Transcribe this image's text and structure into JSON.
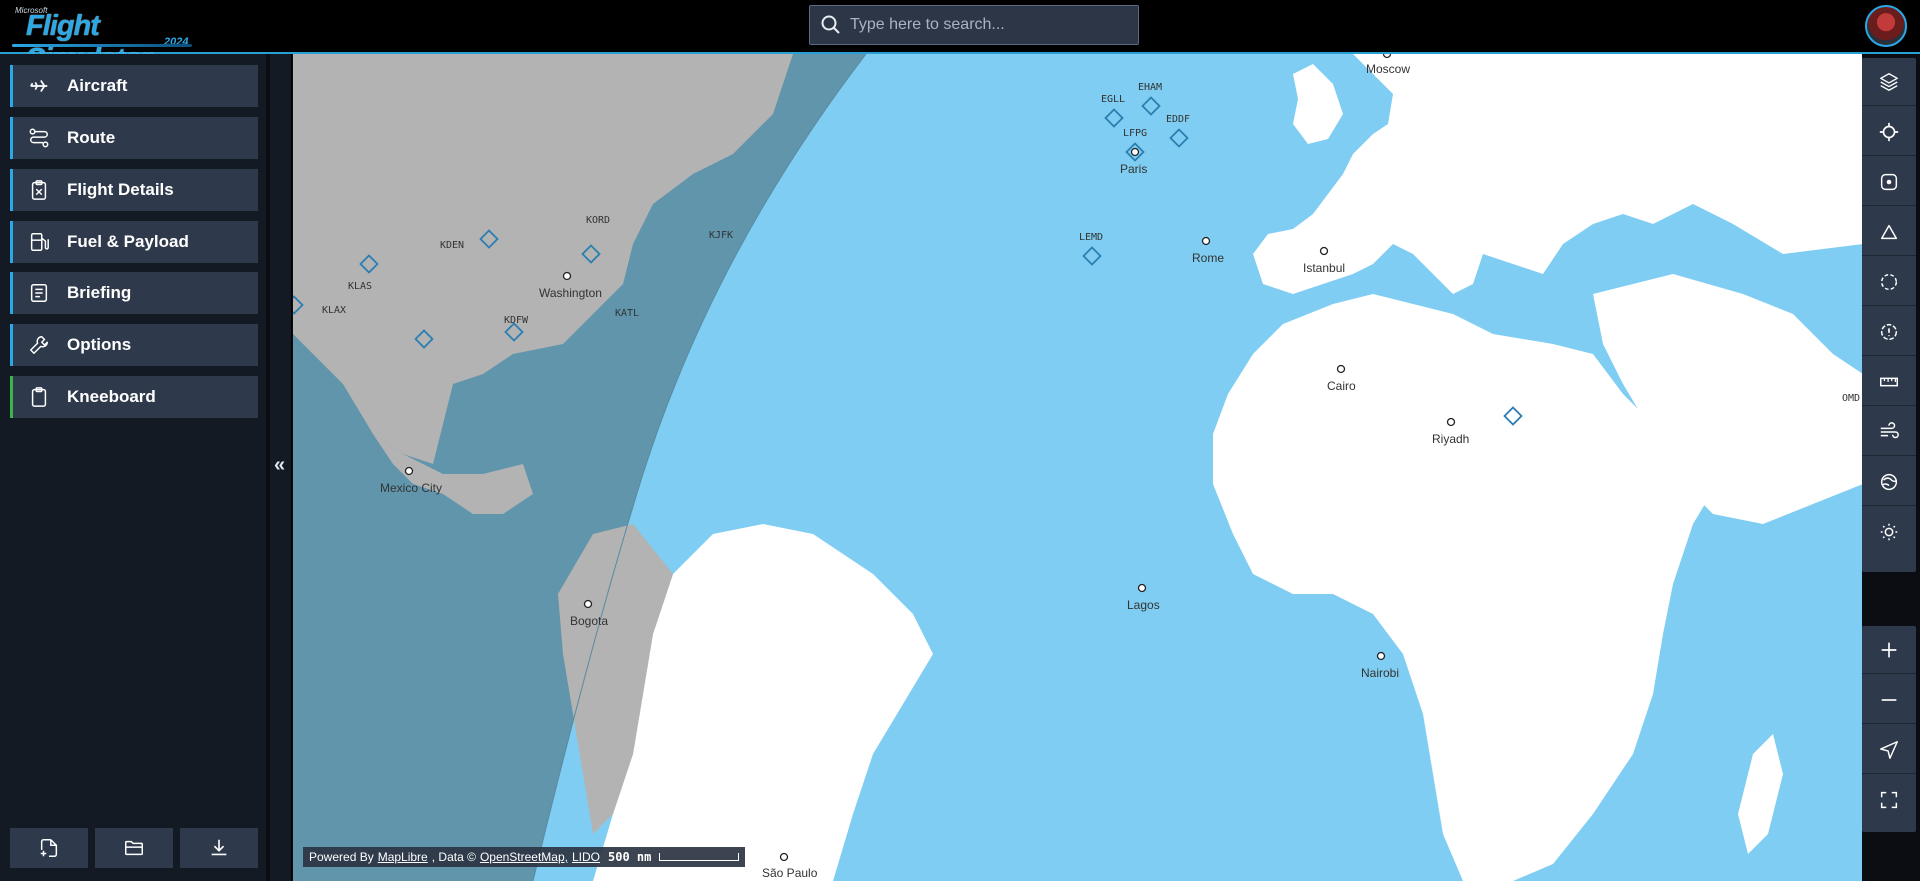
{
  "app": {
    "brand_small": "Microsoft",
    "brand_title": "Flight Simulator",
    "brand_year": "2024"
  },
  "search": {
    "placeholder": "Type here to search..."
  },
  "sidebar": {
    "items": [
      {
        "label": "Aircraft",
        "icon": "airplane-icon"
      },
      {
        "label": "Route",
        "icon": "route-icon"
      },
      {
        "label": "Flight Details",
        "icon": "clipboard-x-icon"
      },
      {
        "label": "Fuel & Payload",
        "icon": "fuel-icon"
      },
      {
        "label": "Briefing",
        "icon": "document-icon"
      },
      {
        "label": "Options",
        "icon": "wrench-icon"
      },
      {
        "label": "Kneeboard",
        "icon": "clipboard-icon"
      }
    ],
    "collapse_glyph": "«",
    "bottom_buttons": [
      "new-file-icon",
      "open-folder-icon",
      "download-icon"
    ]
  },
  "map": {
    "cities": [
      "Moscow",
      "Paris",
      "Rome",
      "Istanbul",
      "Washington",
      "Cairo",
      "Riyadh",
      "Mexico City",
      "Bogota",
      "Lagos",
      "Nairobi",
      "São Paulo"
    ],
    "airports": [
      "EGLL",
      "EHAM",
      "EDDF",
      "LFPG",
      "LEMD",
      "KORD",
      "KJFK",
      "KDEN",
      "KLAS",
      "KLAX",
      "KDFW",
      "KATL",
      "OMD"
    ],
    "attribution": {
      "powered_by": "Powered By",
      "maplibre": "MapLibre",
      "data": ", Data ©",
      "osm": "OpenStreetMap,",
      "lido": "LIDO",
      "scale": "500 nm"
    }
  },
  "tools": [
    "layers-icon",
    "crosshair-icon",
    "center-icon",
    "triangle-icon",
    "circle-dashed-icon",
    "info-circle-icon",
    "ruler-icon",
    "wind-icon",
    "weather-icon",
    "sun-icon"
  ],
  "zoom": [
    "zoom-in-icon",
    "zoom-out-icon",
    "locate-icon",
    "fullscreen-icon"
  ],
  "colors": {
    "accent": "#2aa9e6",
    "water": "#7fcdf2",
    "land": "#ffffff",
    "night_land": "#b3b3b3",
    "night_water": "#6095ab",
    "panel": "#2e3a4c"
  }
}
